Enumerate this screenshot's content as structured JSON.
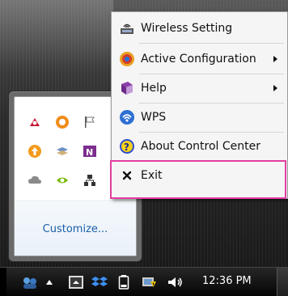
{
  "tray_flyout": {
    "customize_label": "Customize...",
    "icons": [
      "adobe-reader-icon",
      "origin-icon",
      "flag-icon",
      "update-icon",
      "stacks-icon",
      "onenote-icon",
      "cloud-icon",
      "nvidia-icon",
      "network-icon"
    ]
  },
  "context_menu": {
    "items": [
      {
        "label": "Wireless Setting",
        "icon": "wireless-setting-icon",
        "submenu": false
      },
      {
        "label": "Active Configuration",
        "icon": "active-configuration-icon",
        "submenu": true
      },
      {
        "label": "Help",
        "icon": "help-book-icon",
        "submenu": true
      },
      {
        "label": "WPS",
        "icon": "wps-icon",
        "submenu": false
      },
      {
        "label": "About Control Center",
        "icon": "about-icon",
        "submenu": false
      },
      {
        "label": "Exit",
        "icon": "close-icon",
        "submenu": false
      }
    ]
  },
  "taskbar": {
    "clock": "12:36 PM",
    "icons": [
      "network-users-icon",
      "show-hidden-icons-arrow",
      "monitor-icon",
      "dropbox-icon",
      "battery-icon",
      "wireless-warning-icon",
      "volume-icon"
    ]
  },
  "colors": {
    "highlight_border": "#e23fa0",
    "link_blue": "#1a5ea8",
    "menu_background": "#f5f5f5"
  }
}
